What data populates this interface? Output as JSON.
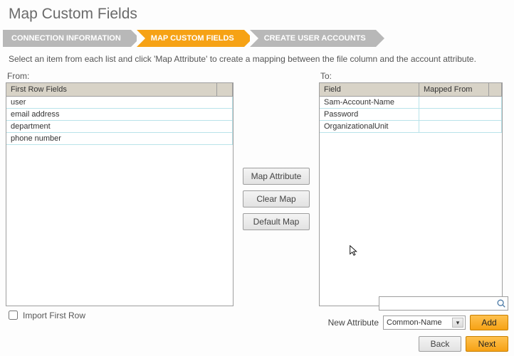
{
  "title": "Map Custom Fields",
  "wizard": {
    "steps": [
      {
        "label": "CONNECTION INFORMATION",
        "active": false
      },
      {
        "label": "MAP CUSTOM FIELDS",
        "active": true
      },
      {
        "label": "CREATE USER ACCOUNTS",
        "active": false
      }
    ]
  },
  "instruction": "Select an item from each list and click 'Map Attribute' to create a mapping between the file column and the account attribute.",
  "from": {
    "label": "From:",
    "header": "First Row Fields",
    "rows": [
      "user",
      "email address",
      "department",
      "phone number"
    ]
  },
  "to": {
    "label": "To:",
    "headers": {
      "field": "Field",
      "mapped": "Mapped From"
    },
    "rows": [
      {
        "field": "Sam-Account-Name",
        "mapped": ""
      },
      {
        "field": "Password",
        "mapped": ""
      },
      {
        "field": "OrganizationalUnit",
        "mapped": ""
      }
    ]
  },
  "center_buttons": {
    "map": "Map Attribute",
    "clear": "Clear Map",
    "defaultm": "Default Map"
  },
  "import_first_row": {
    "label": "Import First Row",
    "checked": false
  },
  "search": {
    "value": ""
  },
  "new_attr": {
    "label": "New Attribute",
    "selected": "Common-Name",
    "add": "Add"
  },
  "nav": {
    "back": "Back",
    "next": "Next"
  }
}
